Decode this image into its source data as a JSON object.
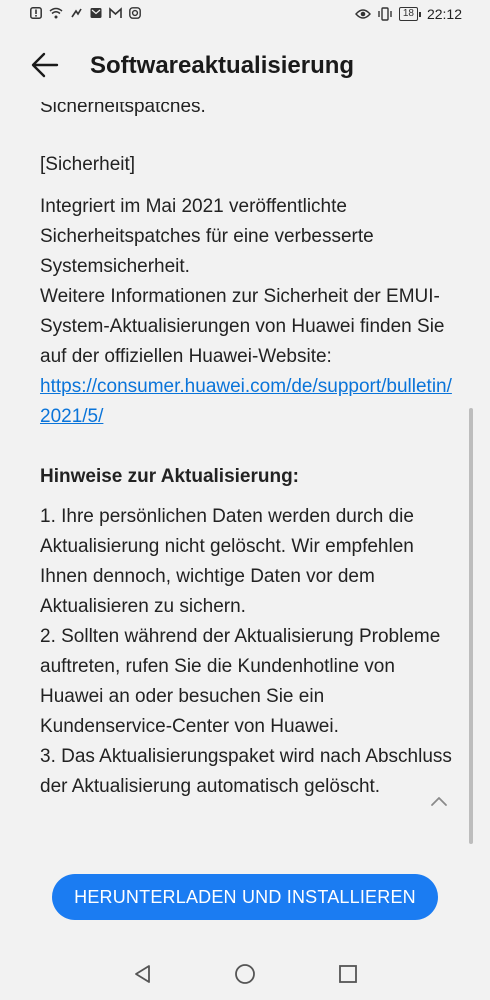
{
  "status_bar": {
    "time": "22:12",
    "battery_level": "18",
    "left_icons": [
      "alert-icon",
      "wifi-icon",
      "link-icon",
      "message-icon",
      "gmail-icon",
      "instagram-icon"
    ],
    "right_icons": [
      "eye-icon",
      "vibrate-icon",
      "battery-icon"
    ]
  },
  "app_bar": {
    "title": "Softwareaktualisierung",
    "back_icon": "arrow-left-icon"
  },
  "content": {
    "cut_line": "Sicherheitspatches.",
    "security_heading": "[Sicherheit]",
    "security_text": "Integriert im Mai 2021 veröffentlichte Sicherheitspatches für eine verbesserte Systemsicherheit.",
    "more_info_text": "Weitere Informationen zur Sicherheit der EMUI-System-Aktualisierungen von Huawei finden Sie auf der offiziellen Huawei-Website:",
    "link_text": "https://consumer.huawei.com/de/support/bulletin/2021/5/",
    "notes_heading": "Hinweise zur Aktualisierung:",
    "notes": [
      "1. Ihre persönlichen Daten werden durch die Aktualisierung nicht gelöscht. Wir empfehlen Ihnen dennoch, wichtige Daten vor dem Aktualisieren zu sichern.",
      "2. Sollten während der Aktualisierung Probleme auftreten, rufen Sie die Kundenhotline von Huawei an oder besuchen Sie ein Kundenservice-Center von Huawei.",
      "3. Das Aktualisierungspaket wird nach Abschluss der Aktualisierung automatisch gelöscht."
    ]
  },
  "collapse_icon": "chevron-up-icon",
  "action_button": {
    "label": "HERUNTERLADEN UND INSTALLIEREN",
    "color": "#1b7cf2"
  },
  "nav_bar": {
    "icons": [
      "back-triangle-icon",
      "home-circle-icon",
      "recents-square-icon"
    ]
  }
}
